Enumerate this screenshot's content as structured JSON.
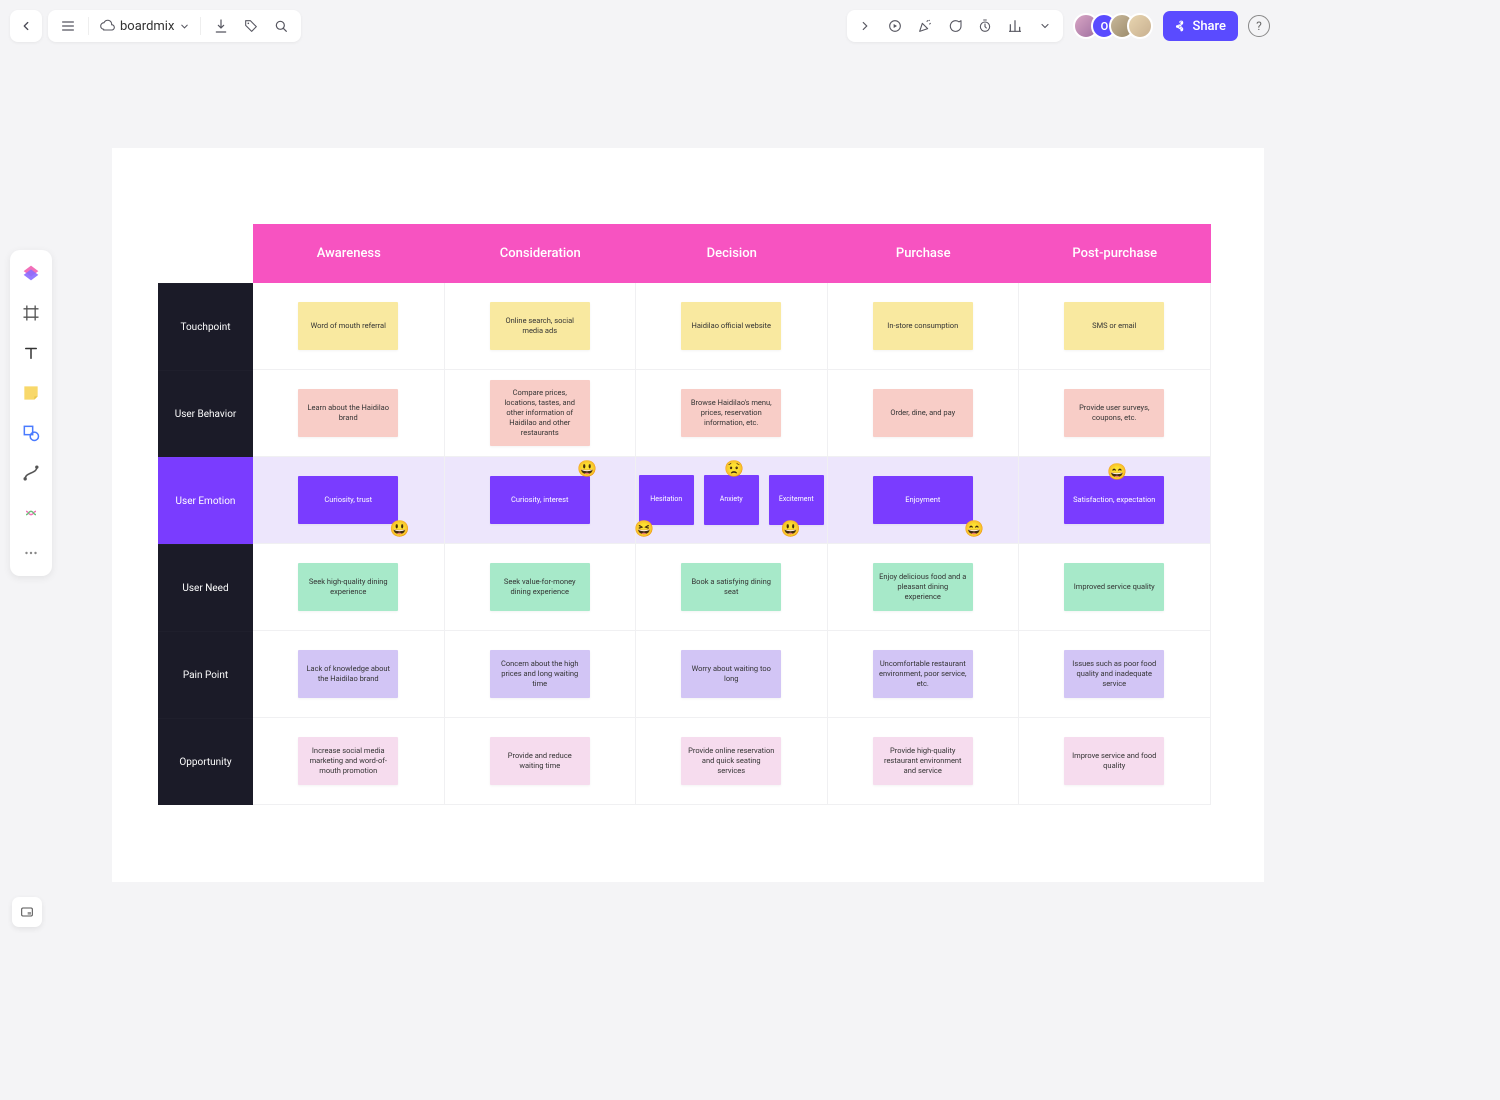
{
  "toolbar": {
    "title": "boardmix",
    "share_label": "Share",
    "avatarInitial": "O"
  },
  "journey": {
    "columns": [
      "Awareness",
      "Consideration",
      "Decision",
      "Purchase",
      "Post-purchase"
    ],
    "rows": [
      {
        "label": "Touchpoint",
        "color": "yellow",
        "cells": [
          "Word of mouth referral",
          "Online search, social media ads",
          "Haidilao official website",
          "In-store consumption",
          "SMS  or email"
        ]
      },
      {
        "label": "User  Behavior",
        "color": "pink",
        "cells": [
          "Learn about the Haidilao brand",
          "Compare prices, locations, tastes, and other information of Haidilao and other restaurants",
          "Browse Haidilao's menu, prices, reservation information, etc.",
          "Order, dine, and pay",
          "Provide  user surveys, coupons, etc."
        ]
      },
      {
        "label": "User  Emotion",
        "color": "purple",
        "cells": [
          "Curiosity, trust",
          "Curiosity, interest",
          [
            "Hesitation",
            "Anxiety",
            "Excitement"
          ],
          "Enjoyment",
          "Satisfaction, expectation"
        ]
      },
      {
        "label": "User  Need",
        "color": "green",
        "cells": [
          "Seek high-quality dining experience",
          "Seek value-for-money dining experience",
          "Book a satisfying dining seat",
          "Enjoy delicious food and a pleasant dining experience",
          "Improved service quality"
        ]
      },
      {
        "label": "Pain  Point",
        "color": "lavender",
        "cells": [
          "Lack of knowledge about the Haidilao brand",
          "Concern about the high prices and long waiting time",
          "Worry about waiting too long",
          "Uncomfortable restaurant environment, poor service, etc.",
          "Issues such as poor food quality and inadequate service"
        ]
      },
      {
        "label": "Opportunity",
        "color": "rose",
        "cells": [
          "Increase social media marketing and word-of-mouth promotion",
          "Provide and reduce waiting time",
          "Provide online reservation and quick seating services",
          "Provide high-quality restaurant environment and service",
          "Improve service and food quality"
        ]
      }
    ],
    "emojis": [
      {
        "row": 2,
        "col": 0,
        "pos": "br",
        "char": "😃"
      },
      {
        "row": 2,
        "col": 1,
        "pos": "tr",
        "char": "😃"
      },
      {
        "row": 2,
        "col": 2,
        "pos": "bl",
        "char": "😆"
      },
      {
        "row": 2,
        "col": 2,
        "pos": "tc",
        "char": "😟"
      },
      {
        "row": 2,
        "col": 2,
        "pos": "brc",
        "char": "😃"
      },
      {
        "row": 2,
        "col": 3,
        "pos": "br",
        "char": "😄"
      },
      {
        "row": 2,
        "col": 4,
        "pos": "tc2",
        "char": "😄"
      }
    ]
  }
}
